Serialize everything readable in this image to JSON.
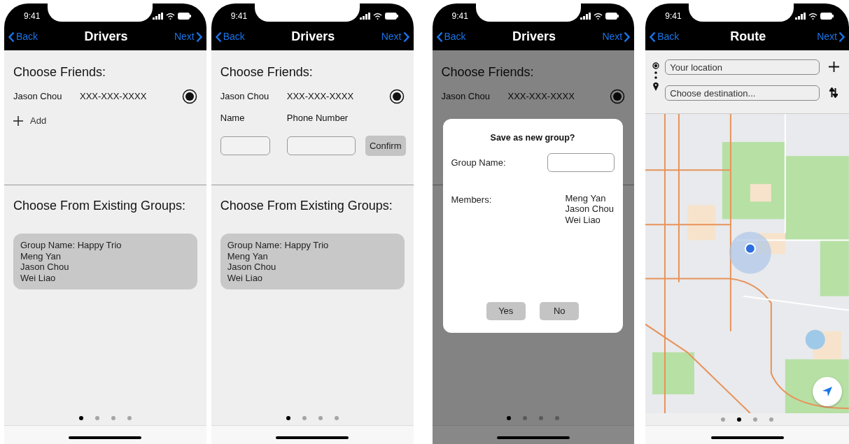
{
  "screens": [
    {
      "kind": "friends",
      "status_time": "9:41",
      "nav": {
        "back": "Back",
        "title": "Drivers",
        "next": "Next"
      },
      "friends_heading": "Choose Friends:",
      "friends": [
        {
          "name": "Jason Chou",
          "phone": "XXX-XXX-XXXX",
          "selected": true
        }
      ],
      "add_label": "Add",
      "groups_heading": "Choose From Existing Groups:",
      "groups": [
        {
          "lines": [
            "Group Name: Happy Trio",
            "Meng Yan",
            "Jason Chou",
            "Wei Liao"
          ]
        }
      ],
      "page_dots": [
        {
          "selected": true
        },
        {
          "selected": false
        },
        {
          "selected": false
        },
        {
          "selected": false
        }
      ]
    },
    {
      "kind": "friends",
      "status_time": "9:41",
      "nav": {
        "back": "Back",
        "title": "Drivers",
        "next": "Next"
      },
      "friends_heading": "Choose Friends:",
      "friends": [
        {
          "name": "Jason Chou",
          "phone": "XXX-XXX-XXXX",
          "selected": true
        }
      ],
      "new_friend": {
        "name_label": "Name",
        "phone_label": "Phone Number",
        "confirm": "Confirm"
      },
      "groups_heading": "Choose From Existing Groups:",
      "groups": [
        {
          "lines": [
            "Group Name: Happy Trio",
            "Meng Yan",
            "Jason Chou",
            "Wei Liao"
          ]
        }
      ],
      "page_dots": [
        {
          "selected": true
        },
        {
          "selected": false
        },
        {
          "selected": false
        },
        {
          "selected": false
        }
      ]
    },
    {
      "kind": "friends",
      "status_time": "9:41",
      "nav": {
        "back": "Back",
        "title": "Drivers",
        "next": "Next"
      },
      "friends_heading": "Choose Friends:",
      "friends": [
        {
          "name": "Jason Chou",
          "phone": "XXX-XXX-XXXX",
          "selected": true
        }
      ],
      "dialog": {
        "title": "Save as new group?",
        "group_name_label": "Group Name:",
        "members_label": "Members:",
        "members": [
          "Meng Yan",
          "Jason Chou",
          "Wei Liao"
        ],
        "buttons": [
          "Yes",
          "No"
        ]
      },
      "page_dots": [
        {
          "selected": true
        },
        {
          "selected": false
        },
        {
          "selected": false
        },
        {
          "selected": false
        }
      ]
    },
    {
      "kind": "route",
      "status_time": "9:41",
      "nav": {
        "back": "Back",
        "title": "Route",
        "next": "Next"
      },
      "route": {
        "from_placeholder": "Your location",
        "to_placeholder": "Choose destination..."
      },
      "page_dots": [
        {
          "selected": false
        },
        {
          "selected": true
        },
        {
          "selected": false
        },
        {
          "selected": false
        }
      ]
    }
  ]
}
